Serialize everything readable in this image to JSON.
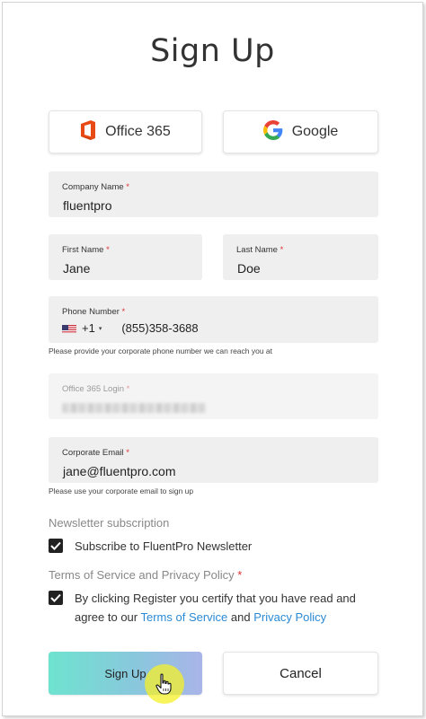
{
  "title": "Sign Up",
  "sso": {
    "office_label": "Office 365",
    "google_label": "Google"
  },
  "fields": {
    "company": {
      "label": "Company Name",
      "required_mark": "*",
      "value": "fluentpro"
    },
    "first_name": {
      "label": "First Name",
      "required_mark": "*",
      "value": "Jane"
    },
    "last_name": {
      "label": "Last Name",
      "required_mark": "*",
      "value": "Doe"
    },
    "phone": {
      "label": "Phone Number",
      "required_mark": "*",
      "country_code": "+1",
      "caret": "▾",
      "value": "(855)358-3688",
      "helper": "Please provide your corporate phone number we can reach you at"
    },
    "office_login": {
      "label": "Office 365 Login",
      "required_mark": "*"
    },
    "email": {
      "label": "Corporate Email",
      "required_mark": "*",
      "value": "jane@fluentpro.com",
      "helper": "Please use your corporate email to sign up"
    }
  },
  "newsletter": {
    "section_label": "Newsletter subscription",
    "checkbox_label": "Subscribe to FluentPro Newsletter",
    "checked": true
  },
  "terms": {
    "section_label": "Terms of Service and Privacy Policy",
    "required_mark": "*",
    "text_before": "By clicking Register you certify that you have read and agree to our ",
    "terms_link": "Terms of Service",
    "text_and": " and ",
    "privacy_link": "Privacy Policy",
    "checked": true
  },
  "buttons": {
    "signup_label": "Sign Up",
    "cancel_label": "Cancel"
  },
  "colors": {
    "link": "#2a8ad4",
    "required": "#d33333",
    "office_brand": "#e74a14",
    "signup_gradient_start": "#6ee3cf",
    "signup_gradient_end": "#a9b4e8",
    "cursor_highlight": "#f6f028"
  },
  "icons": {
    "office": "office365-logo-icon",
    "google": "google-logo-icon",
    "flag": "us-flag-icon",
    "check": "check-icon",
    "cursor": "hand-pointer-icon"
  }
}
